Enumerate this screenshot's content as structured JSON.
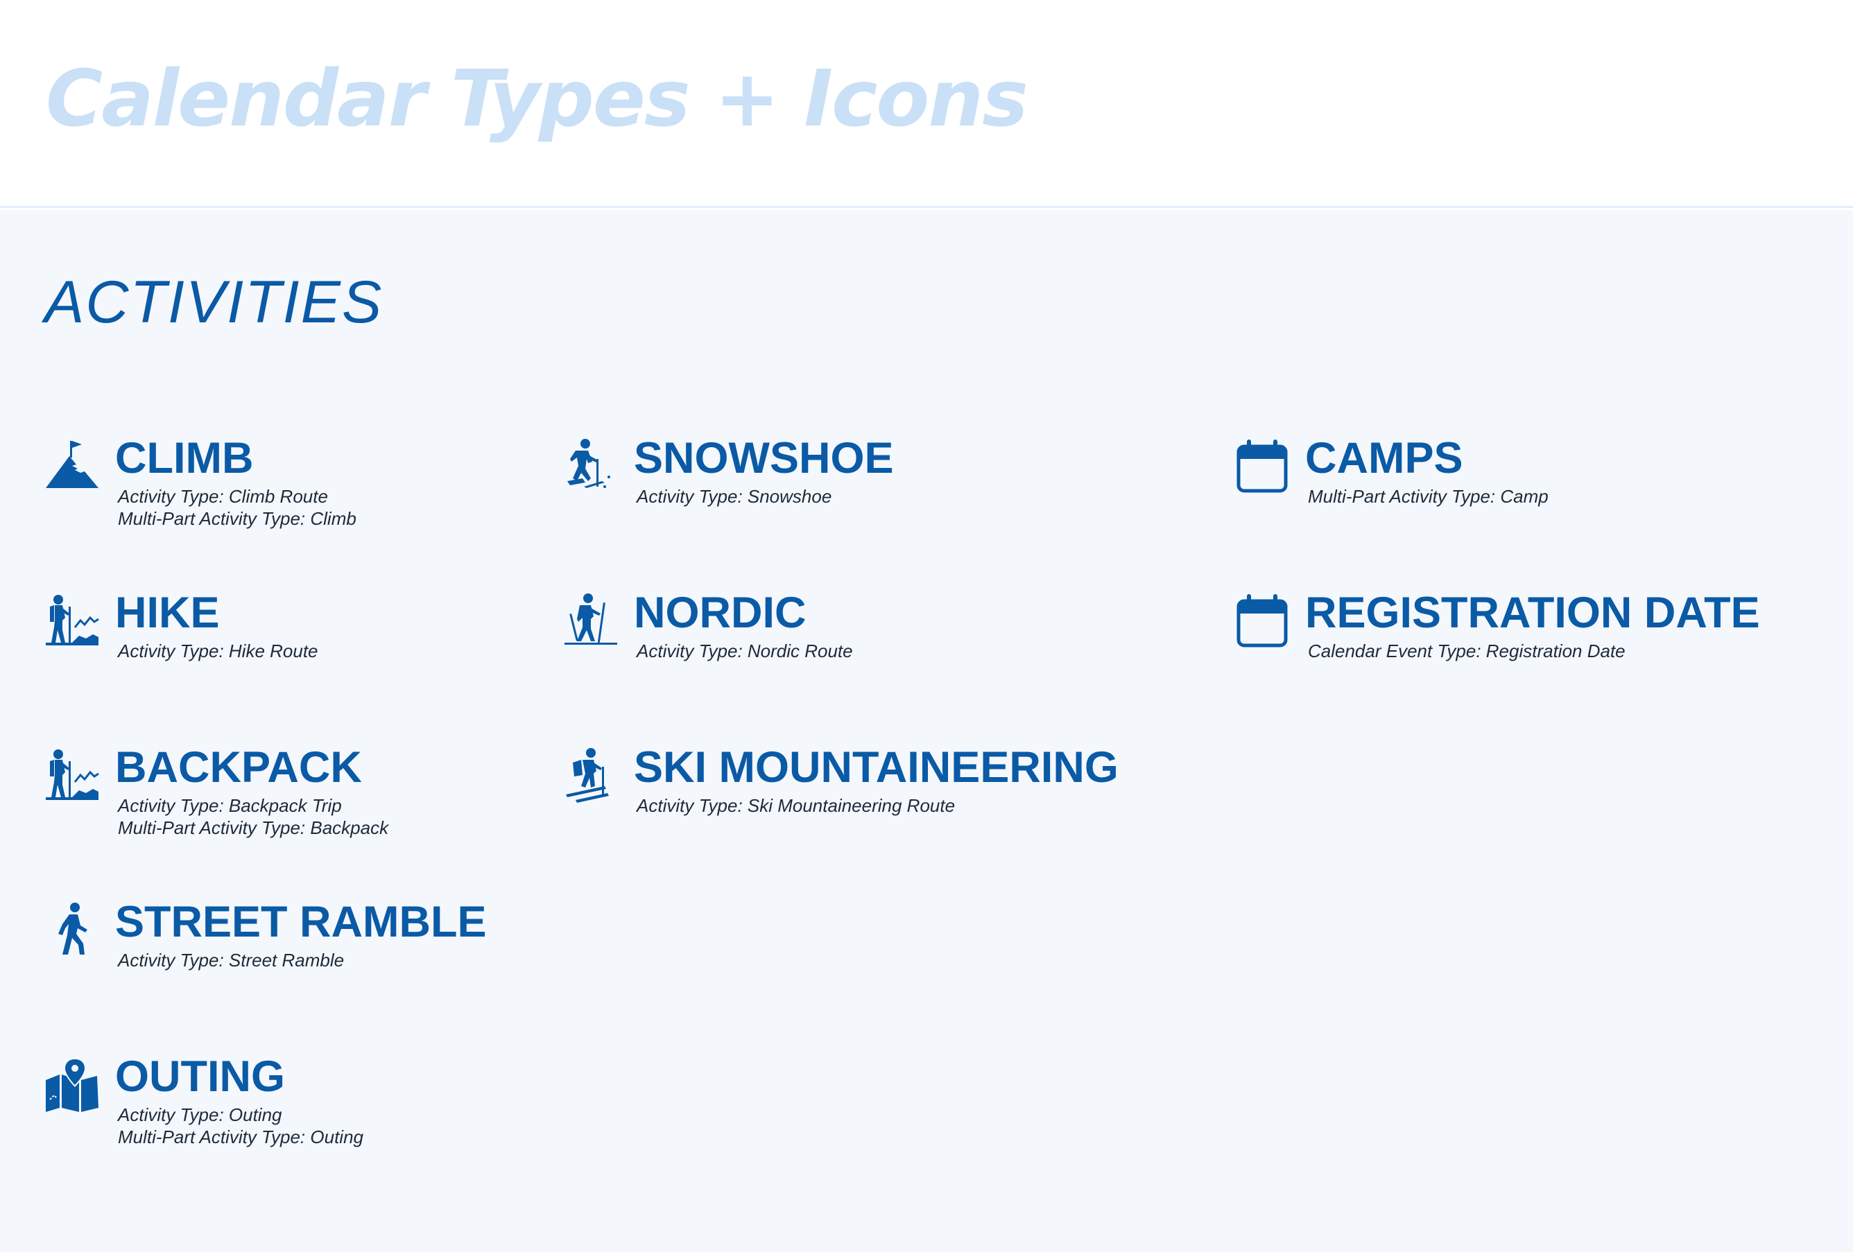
{
  "page": {
    "title": "Calendar Types + Icons",
    "section_title": "ACTIVITIES"
  },
  "colors": {
    "primary": "#0a5aa6",
    "title_light": "#c9e0f7",
    "background": "#f4f7fb",
    "description_text": "#1d2a3a"
  },
  "items": [
    {
      "name": "CLIMB",
      "icon": "mountain-flag-icon",
      "lines": [
        "Activity Type: Climb Route",
        "Multi-Part Activity Type: Climb"
      ]
    },
    {
      "name": "HIKE",
      "icon": "hiker-icon",
      "lines": [
        "Activity Type: Hike Route"
      ]
    },
    {
      "name": "BACKPACK",
      "icon": "hiker-icon",
      "lines": [
        "Activity Type: Backpack Trip",
        "Multi-Part Activity Type: Backpack"
      ]
    },
    {
      "name": "STREET RAMBLE",
      "icon": "walking-person-icon",
      "lines": [
        "Activity Type: Street Ramble"
      ]
    },
    {
      "name": "OUTING",
      "icon": "map-pin-icon",
      "lines": [
        "Activity Type: Outing",
        "Multi-Part Activity Type: Outing"
      ]
    },
    {
      "name": "SNOWSHOE",
      "icon": "snowshoe-icon",
      "lines": [
        "Activity Type: Snowshoe"
      ]
    },
    {
      "name": "NORDIC",
      "icon": "nordic-ski-icon",
      "lines": [
        "Activity Type: Nordic Route"
      ]
    },
    {
      "name": "SKI MOUNTAINEERING",
      "icon": "ski-mountaineering-icon",
      "lines": [
        "Activity Type: Ski Mountaineering Route"
      ]
    },
    {
      "name": "CAMPS",
      "icon": "calendar-icon",
      "lines": [
        "Multi-Part Activity Type: Camp"
      ]
    },
    {
      "name": "REGISTRATION DATE",
      "icon": "calendar-icon",
      "lines": [
        "Calendar Event Type: Registration Date"
      ]
    }
  ]
}
